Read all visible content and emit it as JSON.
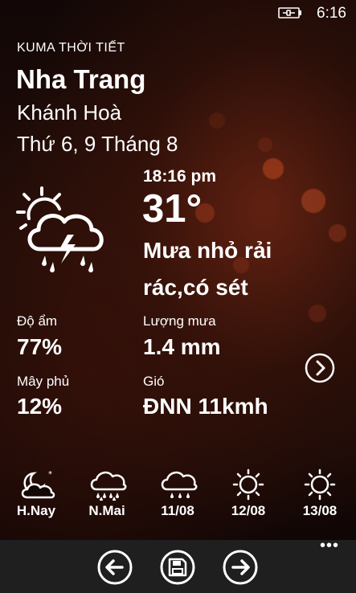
{
  "status_bar": {
    "time": "6:16",
    "battery_icon": "battery-charging-icon"
  },
  "app": {
    "title": "KUMA THỜI TIẾT"
  },
  "location": {
    "city": "Nha Trang",
    "province": "Khánh Hoà",
    "date": "Thứ 6, 9 Tháng 8"
  },
  "current": {
    "time": "18:16 pm",
    "temperature": "31°",
    "condition": "Mưa nhỏ rải rác,có sét",
    "icon": "sun-cloud-thunder-rain-icon"
  },
  "details": {
    "humidity_label": "Độ ẩm",
    "humidity_value": "77%",
    "rain_label": "Lượng mưa",
    "rain_value": "1.4 mm",
    "cloud_label": "Mây phủ",
    "cloud_value": "12%",
    "wind_label": "Gió",
    "wind_value": "ĐNN 11kmh"
  },
  "forecast": [
    {
      "label": "H.Nay",
      "icon": "moon-cloud-icon"
    },
    {
      "label": "N.Mai",
      "icon": "cloud-rain-icon"
    },
    {
      "label": "11/08",
      "icon": "cloud-drizzle-icon"
    },
    {
      "label": "12/08",
      "icon": "sun-icon"
    },
    {
      "label": "13/08",
      "icon": "sun-icon"
    }
  ],
  "app_bar": {
    "ellipsis": "•••"
  },
  "colors": {
    "text": "#ffffff",
    "app_bar_bg": "#1f1f1f",
    "background": "#1a0a07"
  }
}
